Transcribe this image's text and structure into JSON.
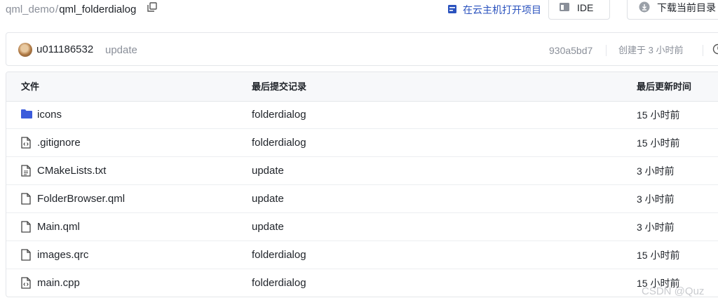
{
  "breadcrumb": {
    "parent": "qml_demo",
    "separator": "/",
    "current": "qml_folderdialog"
  },
  "actions": {
    "open_cloud_label": "在云主机打开项目",
    "ide_label": "IDE",
    "download_label": "下载当前目录"
  },
  "commit": {
    "user": "u011186532",
    "message": "update",
    "hash": "930a5bd7",
    "time": "创建于 3 小时前"
  },
  "table": {
    "headers": {
      "name": "文件",
      "commit": "最后提交记录",
      "time": "最后更新时间"
    },
    "rows": [
      {
        "name": "icons",
        "type": "folder",
        "commit": "folderdialog",
        "time": "15 小时前"
      },
      {
        "name": ".gitignore",
        "type": "code-file",
        "commit": "folderdialog",
        "time": "15 小时前"
      },
      {
        "name": "CMakeLists.txt",
        "type": "text-file",
        "commit": "update",
        "time": "3 小时前"
      },
      {
        "name": "FolderBrowser.qml",
        "type": "file",
        "commit": "update",
        "time": "3 小时前"
      },
      {
        "name": "Main.qml",
        "type": "file",
        "commit": "update",
        "time": "3 小时前"
      },
      {
        "name": "images.qrc",
        "type": "file",
        "commit": "folderdialog",
        "time": "15 小时前"
      },
      {
        "name": "main.cpp",
        "type": "code-file",
        "commit": "folderdialog",
        "time": "15 小时前"
      }
    ]
  },
  "watermark": "CSDN @Quz",
  "colors": {
    "accent": "#2a52be",
    "folder": "#3b5bdb",
    "muted_text": "#8a8f99",
    "border": "#e4e6ea"
  }
}
